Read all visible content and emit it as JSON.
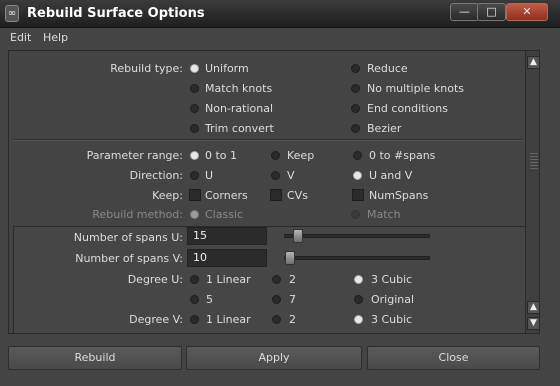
{
  "window": {
    "title": "Rebuild Surface Options",
    "app_icon": "maya-logo-icon",
    "controls": {
      "minimize": "—",
      "maximize": "□",
      "close": "✕"
    }
  },
  "menu": {
    "items": [
      "Edit",
      "Help"
    ]
  },
  "rebuild_type": {
    "label": "Rebuild type:",
    "options": [
      "Uniform",
      "Reduce",
      "Match knots",
      "No multiple knots",
      "Non-rational",
      "End conditions",
      "Trim convert",
      "Bezier"
    ],
    "selected": "Uniform"
  },
  "parameter_range": {
    "label": "Parameter range:",
    "options": [
      "0 to 1",
      "Keep",
      "0 to #spans"
    ],
    "selected": "0 to 1"
  },
  "direction": {
    "label": "Direction:",
    "options": [
      "U",
      "V",
      "U and V"
    ],
    "selected": "U and V"
  },
  "keep": {
    "label": "Keep:",
    "options": [
      "Corners",
      "CVs",
      "NumSpans"
    ]
  },
  "rebuild_method": {
    "label": "Rebuild method:",
    "options": [
      "Classic",
      "Match"
    ],
    "selected": "Classic",
    "enabled": false
  },
  "spans_u": {
    "label": "Number of spans U:",
    "value": "15"
  },
  "spans_v": {
    "label": "Number of spans V:",
    "value": "10"
  },
  "degree_u": {
    "label": "Degree U:",
    "options": [
      "1 Linear",
      "2",
      "3 Cubic",
      "5",
      "7",
      "Original"
    ],
    "selected": "3 Cubic"
  },
  "degree_v": {
    "label": "Degree V:",
    "options": [
      "1 Linear",
      "2",
      "3 Cubic"
    ],
    "selected": "3 Cubic"
  },
  "scrollbar": {
    "up": "▲",
    "down": "▼"
  },
  "buttons": {
    "rebuild": "Rebuild",
    "apply": "Apply",
    "close": "Close"
  }
}
